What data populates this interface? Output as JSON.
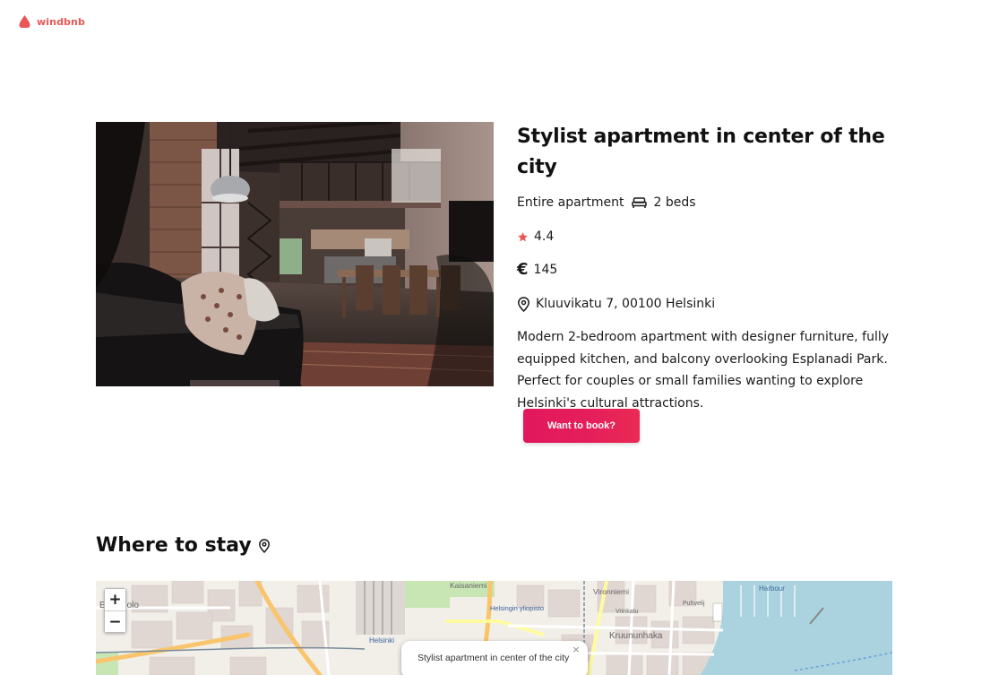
{
  "brand": {
    "name": "windbnb",
    "color": "#eb5757",
    "icon": "logo-icon"
  },
  "listing": {
    "title": "Stylist apartment in center of the city",
    "type": "Entire apartment",
    "beds": "2 beds",
    "rating": "4.4",
    "currency_symbol": "€",
    "price": "145",
    "address": "Kluuvikatu 7, 00100 Helsinki",
    "description": "Modern 2-bedroom apartment with designer furniture, fully equipped kitchen, and balcony overlooking Esplanadi Park. Perfect for couples or small families wanting to explore Helsinki's cultural attractions.",
    "book_label": "Want to book?",
    "icons": [
      "bed-icon",
      "star-icon",
      "euro-icon",
      "location-pin-icon"
    ],
    "accent_color": "#e2175e",
    "star_color": "#eb5757"
  },
  "location_section": {
    "title": "Where to stay",
    "icon": "location-pin-icon"
  },
  "map": {
    "zoom_in": "+",
    "zoom_out": "−",
    "labels": [
      "Kaisaniemi",
      "Helsingin yliopisto",
      "Vironniemi",
      "Kruununhaka",
      "Helsinki",
      "Esplanolo",
      "Harbour",
      "Puhvelij",
      "Vrinkatu"
    ],
    "popup_text": "Stylist apartment in center of the city",
    "popup_close": "×"
  }
}
